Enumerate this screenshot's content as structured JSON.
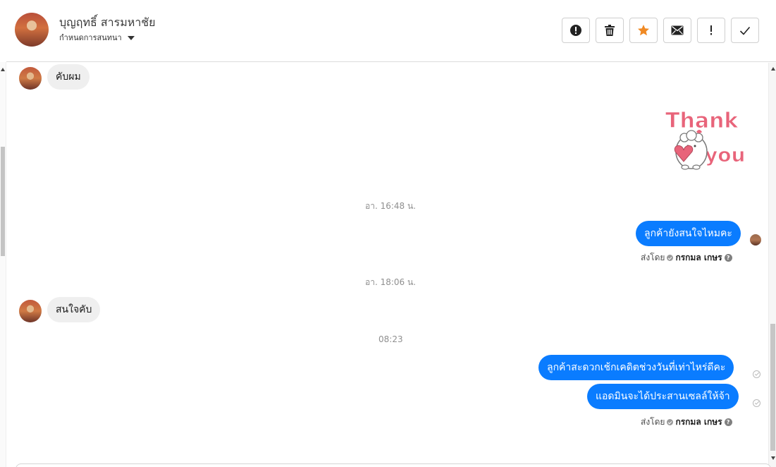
{
  "contact": {
    "name": "บุญฤทธิ์ สารมหาชัย",
    "subtitle": "กำหนดการสนทนา",
    "avatar_icon": "contact-avatar"
  },
  "toolbar": {
    "buttons": [
      {
        "name": "spam",
        "icon": "alert-circle-icon"
      },
      {
        "name": "delete",
        "icon": "trash-icon"
      },
      {
        "name": "star",
        "icon": "star-icon"
      },
      {
        "name": "mark-unread",
        "icon": "envelope-icon"
      },
      {
        "name": "important",
        "icon": "exclamation-icon"
      },
      {
        "name": "done",
        "icon": "check-icon"
      }
    ],
    "star_color": "#f08a24"
  },
  "conversation": {
    "messages": [
      {
        "direction": "in",
        "text": "คับผม"
      },
      {
        "direction": "out",
        "type": "sticker",
        "sticker_text": [
          "Thank",
          "you"
        ]
      },
      {
        "type": "timestamp",
        "text": "อา. 16:48 น."
      },
      {
        "direction": "out",
        "text": "ลูกค้ายังสนใจไหมคะ"
      },
      {
        "type": "sent-by",
        "prefix": "ส่งโดย",
        "agent": "กรกมล เกษร"
      },
      {
        "type": "timestamp",
        "text": "อา. 18:06 น."
      },
      {
        "direction": "in",
        "text": "สนใจคับ"
      },
      {
        "type": "timestamp",
        "text": "08:23"
      },
      {
        "direction": "out",
        "text": "ลูกค้าสะดวกเช้กเคดิตช่วงวันที่เท่าไหร่ดีคะ"
      },
      {
        "direction": "out",
        "text": "แอดมินจะได้ประสานเซลล์ให้จ้า"
      },
      {
        "type": "sent-by",
        "prefix": "ส่งโดย",
        "agent": "กรกมล เกษร"
      }
    ]
  },
  "colors": {
    "outgoing_bubble": "#0a7cff",
    "incoming_bubble": "#efefef",
    "sticker_text": "#e8647a"
  }
}
